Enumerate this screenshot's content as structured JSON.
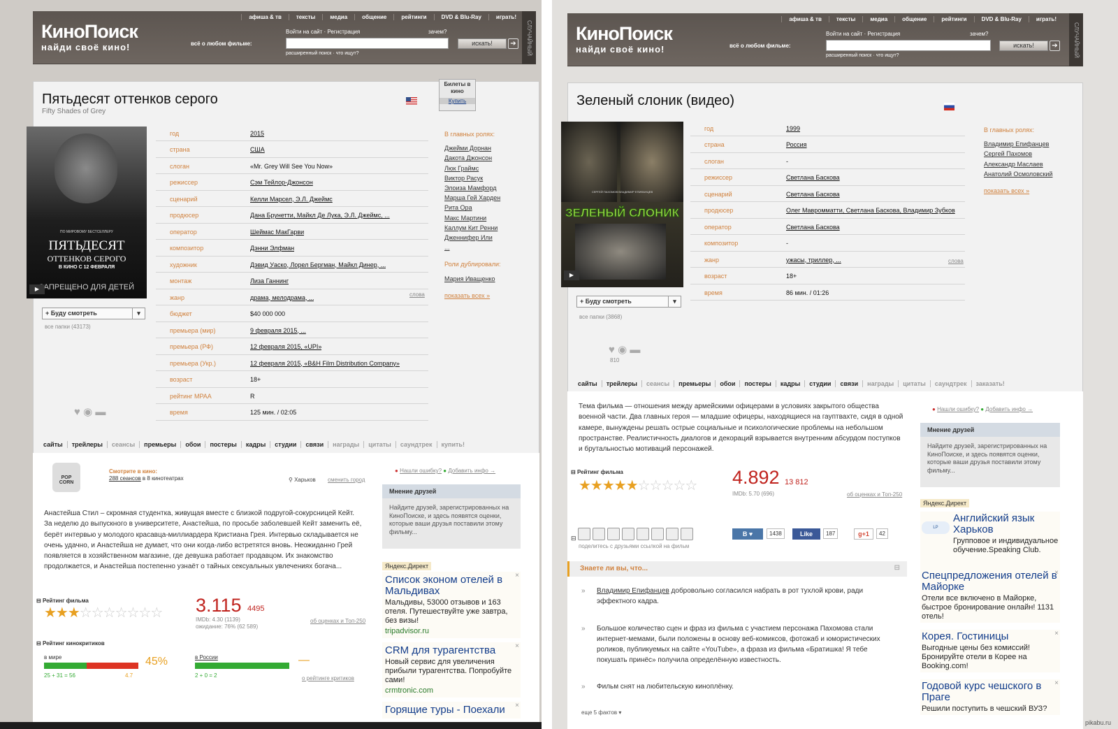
{
  "nav": [
    "афиша & тв",
    "тексты",
    "медиа",
    "общение",
    "рейтинги",
    "DVD & Blu-Ray",
    "играть!"
  ],
  "logo": "КиноПоиск",
  "tagline": "найди своё кино!",
  "about": "всё о любом фильме:",
  "login": "Войти на сайт",
  "register": "Регистрация",
  "why": "зачем?",
  "search_btn": "искать!",
  "adv_search": "расширенный поиск · что ищут?",
  "random": "СЛУЧАЙНЫЙ",
  "left": {
    "title": "Пятьдесят оттенков серого",
    "orig": "Fifty Shades of Grey",
    "tickets": "Билеты в кино",
    "buy": "Купить",
    "poster_lines": [
      "ПЯТЬДЕСЯТ",
      "ОТТЕНКОВ СЕРОГО",
      "В КИНО С 12 ФЕВРАЛЯ",
      "ЗАПРЕЩЕНО ДЛЯ ДЕТЕЙ"
    ],
    "poster_small": "ПО МИРОВОМУ БЕСТСЕЛЛЕРУ",
    "watch": "Буду смотреть",
    "folders": "все папки (43173)",
    "info": [
      [
        "год",
        "2015"
      ],
      [
        "страна",
        "США"
      ],
      [
        "слоган",
        "«Mr. Grey Will See You Now»"
      ],
      [
        "режиссер",
        "Сэм Тейлор-Джонсон"
      ],
      [
        "сценарий",
        "Келли Марсел, Э.Л. Джеймс"
      ],
      [
        "продюсер",
        "Дана Брунетти, Майкл Де Лука, Э.Л. Джеймс, ..."
      ],
      [
        "оператор",
        "Шеймас МакГарви"
      ],
      [
        "композитор",
        "Дэнни Элфман"
      ],
      [
        "художник",
        "Дэвид Уаско, Лорел Бергман, Майкл Динер, ..."
      ],
      [
        "монтаж",
        "Лиза Ганнинг"
      ],
      [
        "жанр",
        "драма, мелодрама, ..."
      ],
      [
        "бюджет",
        "$40 000 000"
      ],
      [
        "премьера (мир)",
        "9 февраля 2015, ..."
      ],
      [
        "премьера (РФ)",
        "12 февраля 2015, «UPI»"
      ],
      [
        "премьера (Укр.)",
        "12 февраля 2015, «B&H Film Distribution Company»"
      ],
      [
        "возраст",
        "18+"
      ],
      [
        "рейтинг MPAA",
        "R"
      ],
      [
        "время",
        "125 мин. / 02:05"
      ]
    ],
    "words": "слова",
    "cast_head": "В главных ролях:",
    "cast": [
      "Джейми Дорнан",
      "Дакота Джонсон",
      "Люк Граймс",
      "Виктор Расук",
      "Элоиза Мамфорд",
      "Марша Гей Харден",
      "Рита Ора",
      "Макс Мартини",
      "Каллум Кит Ренни",
      "Дженнифер Или",
      "..."
    ],
    "dub_head": "Роли дублировали:",
    "dub": [
      "Мария Иващенко"
    ],
    "show_all": "показать всех »",
    "tabs": [
      "сайты",
      "трейлеры",
      "сеансы",
      "премьеры",
      "обои",
      "постеры",
      "кадры",
      "студии",
      "связи",
      "награды",
      "цитаты",
      "саундтрек",
      "купить!"
    ],
    "watch_cinema": "Смотрите в кино:",
    "sessions": "288 сеансов",
    "sessions_tail": "в 8 кинотеатрах",
    "city": "Харьков",
    "change_city": "сменить город",
    "error": "Нашли ошибку?",
    "add_info": "Добавить инфо →",
    "desc": "Анастейша Стил – скромная студентка, живущая вместе с близкой подругой-сокурсницей Кейт. За неделю до выпускного в университете, Анастейша, по просьбе заболевшей Кейт заменить её, берёт интервью у молодого красавца-миллиардера Кристиана Грея. Интервью складывается не очень удачно, и Анастейша не думает, что они когда-либо встретятся вновь. Неожиданно Грей появляется в хозяйственном магазине, где девушка работает продавцом. Их знакомство продолжается, и Анастейша постепенно узнаёт о тайных сексуальных увлечениях богача...",
    "friends_head": "Мнение друзей",
    "friends_body": "Найдите друзей, зарегистрированных на КиноПоиске, и здесь появятся оценки, которые ваши друзья поставили этому фильму...",
    "rating_label": "Рейтинг фильма",
    "rating": "3.115",
    "votes": "4495",
    "imdb": "IMDb: 4.30 (1139)",
    "expect": "ожидание: 76% (62 589)",
    "top250": "об оценках и Топ-250",
    "critics": "Рейтинг кинокритиков",
    "world": "в мире",
    "world_pct": "45%",
    "world_sum": "25 + 31 = 56",
    "world_avg": "4.7",
    "russia": "в России",
    "russia_pct": "—",
    "russia_sum": "2 + 0 = 2",
    "critics_link": "о рейтинге критиков",
    "direct": "Яндекс.Директ",
    "ads": [
      [
        "Список эконом отелей в Мальдивах",
        "Мальдивы, 53000 отзывов и 163 отеля. Путешествуйте уже завтра, без визы!",
        "tripadvisor.ru"
      ],
      [
        "CRM для турагентства",
        "Новый сервис для увеличения прибыли турагентства. Попробуйте сами!",
        "crmtronic.com"
      ],
      [
        "Горящие туры - Поехали",
        "",
        " "
      ]
    ]
  },
  "right": {
    "title": "Зеленый слоник (видео)",
    "poster_text": "ЗЕЛЕНЫЙ СЛОНИК",
    "poster_top": "СЕРГЕЙ ПАХОМОВ   ВЛАДИМИР ЕПИФАНЦЕВ",
    "watch": "Буду смотреть",
    "folders": "все папки (3868)",
    "likes": "810",
    "info": [
      [
        "год",
        "1999"
      ],
      [
        "страна",
        "Россия"
      ],
      [
        "слоган",
        "-"
      ],
      [
        "режиссер",
        "Светлана Баскова"
      ],
      [
        "сценарий",
        "Светлана Баскова"
      ],
      [
        "продюсер",
        "Олег Мавромматти, Светлана Баскова, Владимир Зубков"
      ],
      [
        "оператор",
        "Светлана Баскова"
      ],
      [
        "композитор",
        "-"
      ],
      [
        "жанр",
        "ужасы, триллер, ..."
      ],
      [
        "возраст",
        "18+"
      ],
      [
        "время",
        "86 мин. / 01:26"
      ]
    ],
    "words": "слова",
    "cast_head": "В главных ролях:",
    "cast": [
      "Владимир Епифанцев",
      "Сергей Пахомов",
      "Александр Маслаев",
      "Анатолий Осмоловский"
    ],
    "show_all": "показать всех »",
    "tabs": [
      "сайты",
      "трейлеры",
      "сеансы",
      "премьеры",
      "обои",
      "постеры",
      "кадры",
      "студии",
      "связи",
      "награды",
      "цитаты",
      "саундтрек",
      "заказать!"
    ],
    "desc": "Тема фильма — отношения между армейскими офицерами в условиях закрытого общества военной части. Два главных героя — младшие офицеры, находящиеся на гауптвахте, сидя в одной камере, вынуждены решать острые социальные и психологические проблемы на небольшом пространстве. Реалистичность диалогов и декораций взрывается внутренним абсурдом поступков и брутальностью мотиваций персонажей.",
    "error": "Нашли ошибку?",
    "add_info": "Добавить инфо →",
    "friends_head": "Мнение друзей",
    "friends_body": "Найдите друзей, зарегистрированных на КиноПоиске, и здесь появятся оценки, которые ваши друзья поставили этому фильму...",
    "rating_label": "Рейтинг фильма",
    "rating": "4.892",
    "votes": "13 812",
    "imdb": "IMDb: 5.70 (696)",
    "top250": "об оценках и Топ-250",
    "share_text": "поделитесь с друзьями ссылкой на фильм",
    "vk": "1438",
    "fb": "Like",
    "fbc": "187",
    "gp": "+1",
    "gpc": "42",
    "facts_head": "Знаете ли вы, что...",
    "facts": [
      {
        "link": "Владимир Епифанцев",
        "text": " добровольно согласился набрать в рот тухлой крови, ради эффектного кадра."
      },
      {
        "link": "",
        "text": "Большое количество сцен и фраз из фильма с участием персонажа Пахомова стали интернет-мемами, были положены в основу веб-комиксов, фотожаб и юмористических роликов, публикуемых на сайте «YouTube», а фраза из фильма «Братишка! Я тебе покушать принёс» получила определённую известность."
      },
      {
        "link": "",
        "text": "Фильм снят на любительскую киноплёнку."
      }
    ],
    "more_facts": "еще 5 фактов",
    "direct": "Яндекс.Директ",
    "ads": [
      [
        "Английский язык Харьков",
        "Групповое и индивидуальное обучение.Speaking Club."
      ],
      [
        "Спецпредложения отелей в Майорке",
        "Отели все включено в Майорке, быстрое бронирование онлайн! 1131 отель!"
      ],
      [
        "Корея. Гостиницы",
        "Выгодные цены без комиссий! Бронируйте отели в Корее на Booking.com!"
      ],
      [
        "Годовой курс чешского в Праге",
        "Решили поступить в чешский ВУЗ?"
      ]
    ]
  },
  "watermark": "pikabu.ru"
}
